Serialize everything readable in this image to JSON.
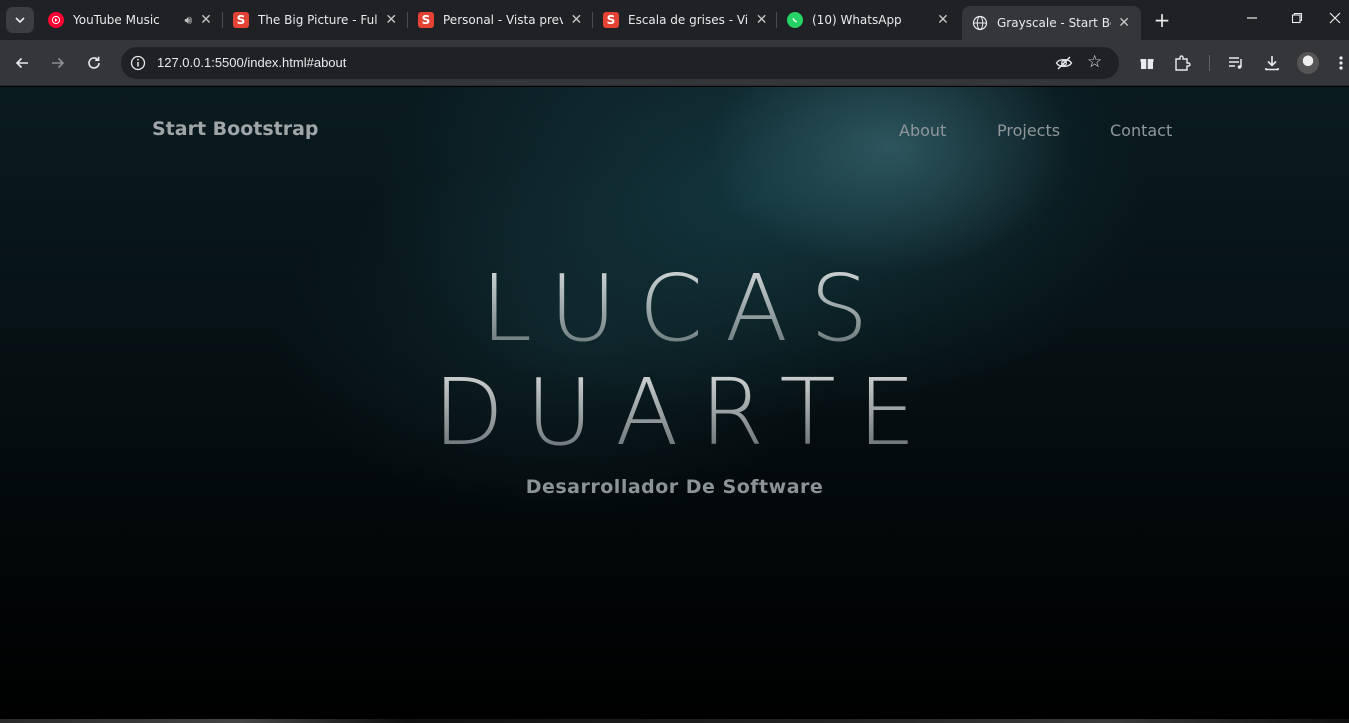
{
  "browser": {
    "tabs": [
      {
        "title": "YouTube Music",
        "favicon": "youtube-music-icon",
        "audio": true
      },
      {
        "title": "The Big Picture - Full",
        "favicon": "s-logo-icon"
      },
      {
        "title": "Personal - Vista previ",
        "favicon": "s-logo-icon"
      },
      {
        "title": "Escala de grises - Vist",
        "favicon": "s-logo-icon"
      },
      {
        "title": "(10) WhatsApp",
        "favicon": "whatsapp-icon"
      },
      {
        "title": "Grayscale - Start Boot",
        "favicon": "globe-icon",
        "active": true
      }
    ],
    "url": "127.0.0.1:5500/index.html#about",
    "favicon_letter": "S"
  },
  "site": {
    "brand": "Start Bootstrap",
    "nav": [
      "About",
      "Projects",
      "Contact"
    ],
    "hero_line1": "LUCAS",
    "hero_line2": "DUARTE",
    "subtitle": "Desarrollador De Software"
  },
  "colors": {
    "chrome_tabstrip": "#202124",
    "chrome_toolbar": "#35363a",
    "page_bg": "#061114",
    "nav_text": "#8f979a"
  }
}
